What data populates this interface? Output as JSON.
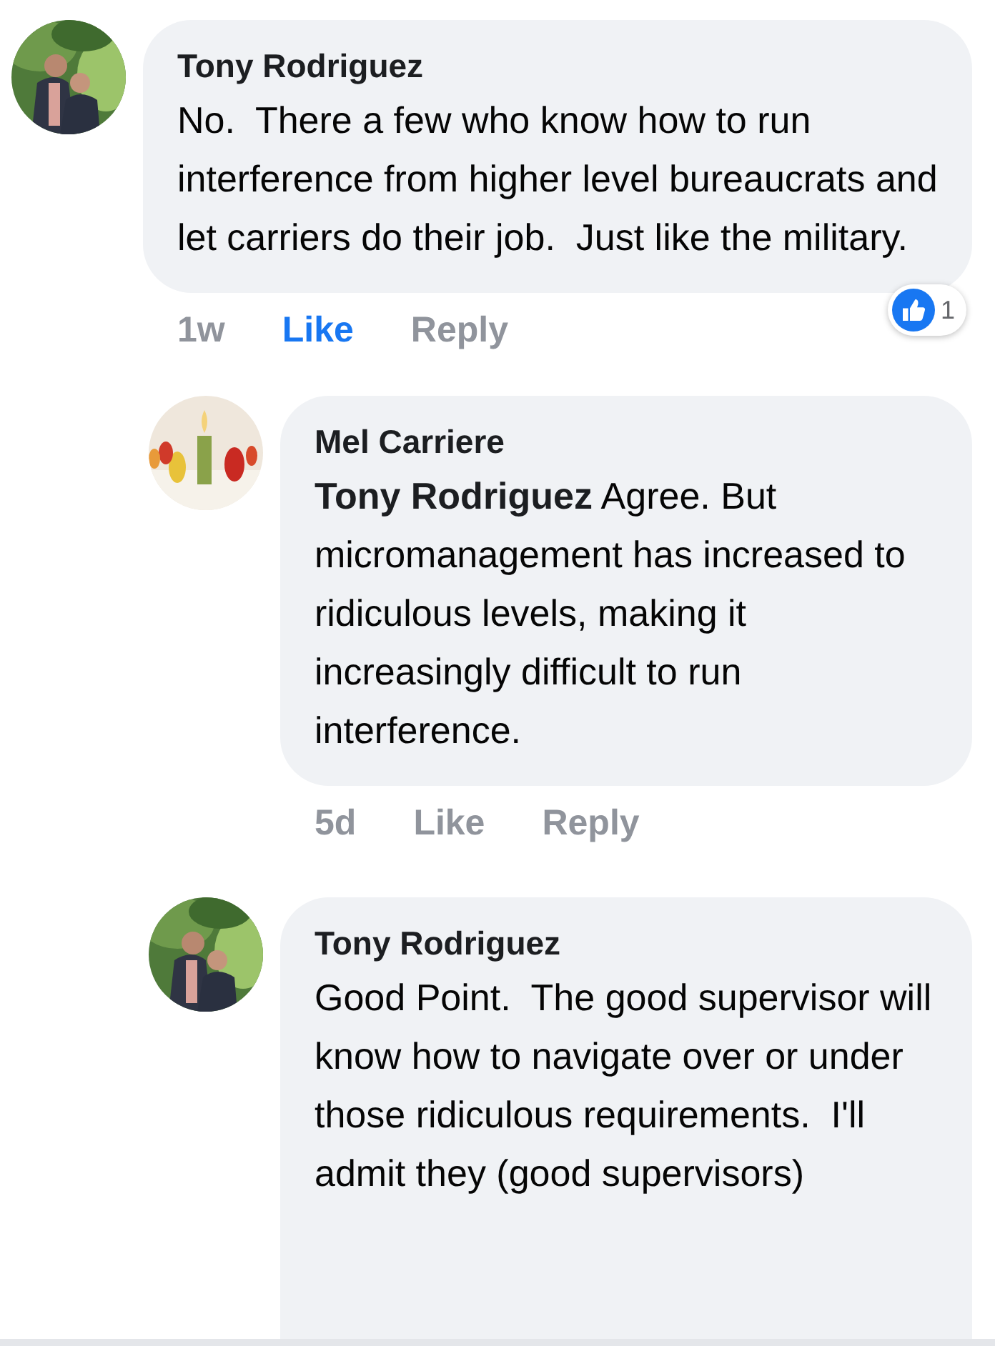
{
  "comments": [
    {
      "avatar": {
        "kind": "garden"
      },
      "author": "Tony Rodriguez",
      "text": "No.  There a few who know how to run interference from higher level bureaucrats and  let carriers do their job.  Just like the military.",
      "reply": false,
      "actions": {
        "time": "1w",
        "like": "Like",
        "liked": true,
        "reply": "Reply"
      },
      "reactions": {
        "count": "1"
      }
    },
    {
      "avatar": {
        "kind": "table"
      },
      "author": "Mel Carriere",
      "text": "**Tony Rodriguez** Agree. But micromanagement has increased to ridiculous levels, making it increasingly difficult to run interference.",
      "reply": true,
      "actions": {
        "time": "5d",
        "like": "Like",
        "liked": false,
        "reply": "Reply"
      }
    },
    {
      "avatar": {
        "kind": "garden"
      },
      "author": "Tony Rodriguez",
      "text": "Good Point.  The good supervisor will know how to navigate over or under those ridiculous requirements.  I'll admit they (good supervisors)",
      "reply": true
    }
  ]
}
